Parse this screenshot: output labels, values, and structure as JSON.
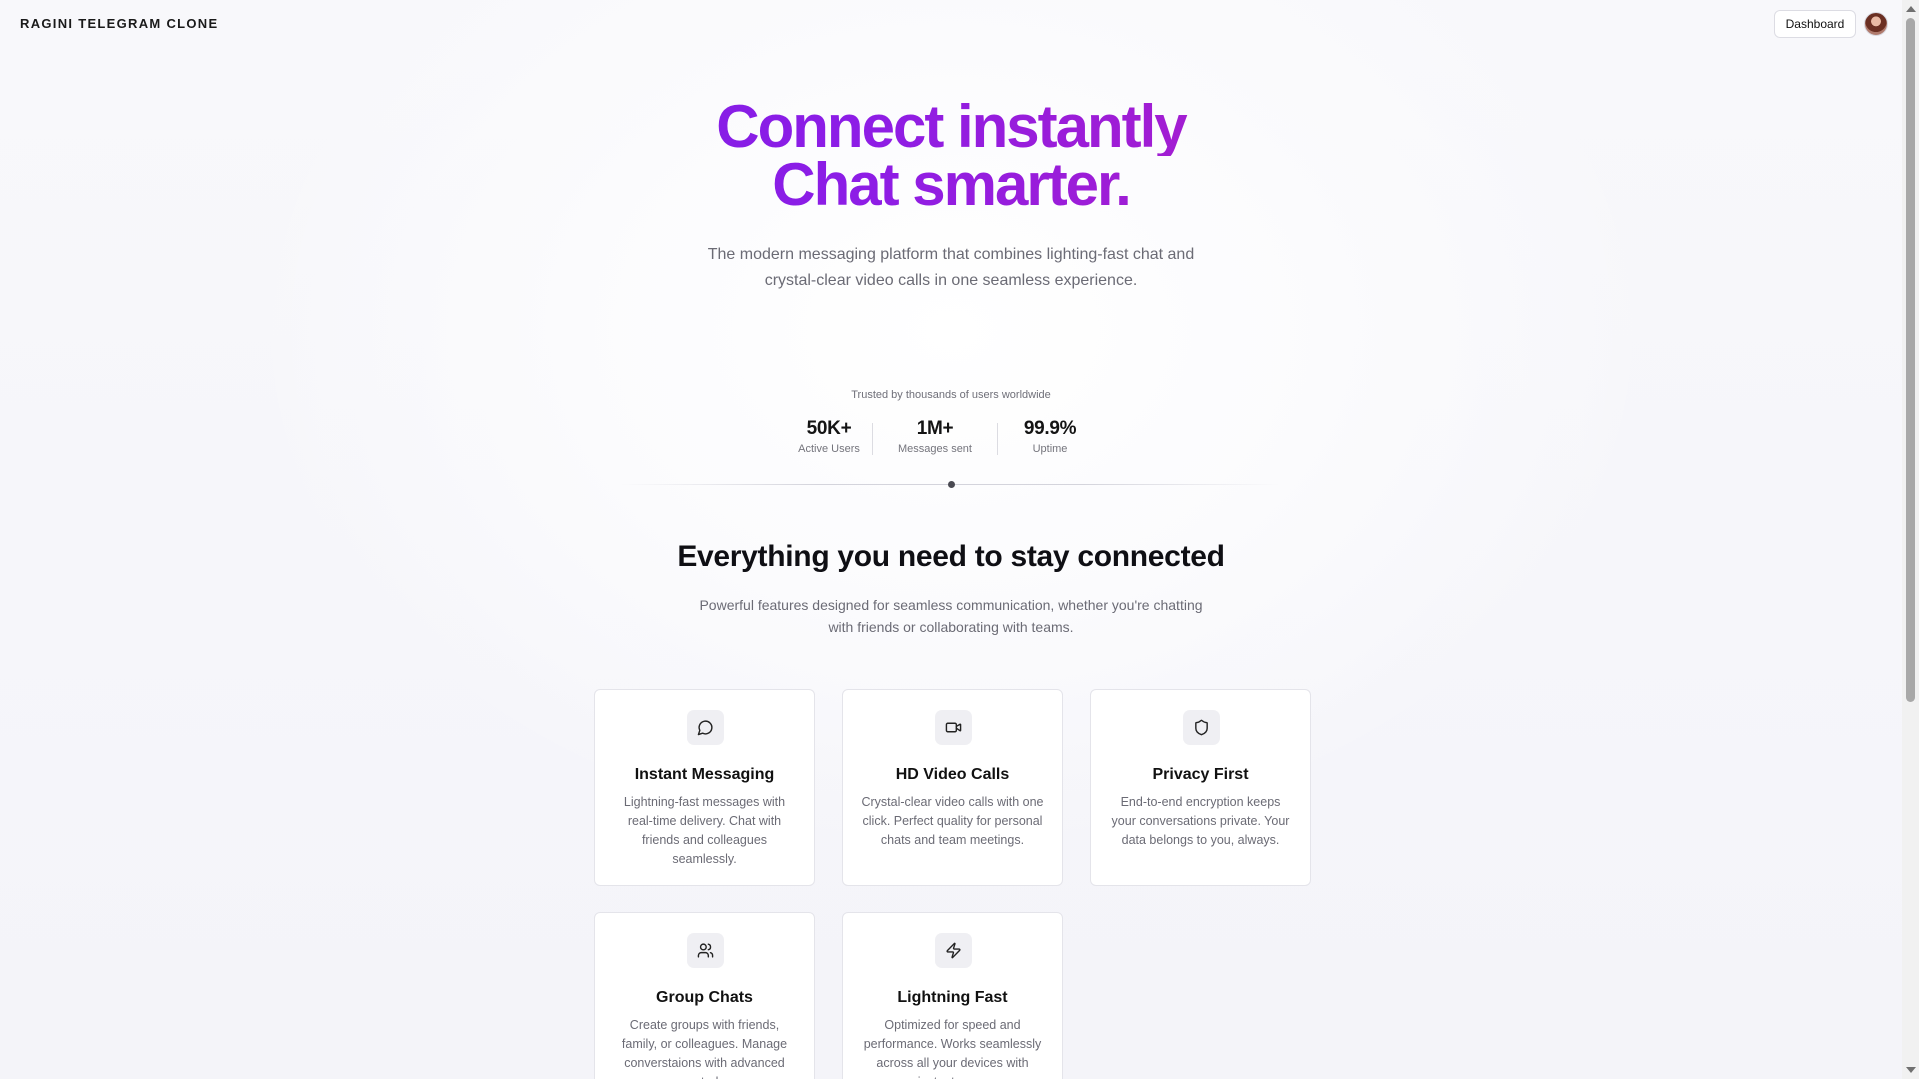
{
  "header": {
    "brand": "RAGINI TELEGRAM CLONE",
    "dashboard_label": "Dashboard"
  },
  "hero": {
    "title_line1": "Connect instantly",
    "title_line2": "Chat smarter.",
    "subtitle": "The modern messaging platform that combines lighting-fast chat and crystal-clear video calls in one seamless experience."
  },
  "stats": {
    "caption": "Trusted by thousands of users worldwide",
    "items": [
      {
        "value": "50K+",
        "label": "Active Users"
      },
      {
        "value": "1M+",
        "label": "Messages sent"
      },
      {
        "value": "99.9%",
        "label": "Uptime"
      }
    ]
  },
  "features": {
    "title": "Everything you need to stay connected",
    "subtitle": "Powerful features designed for seamless communication, whether you're chatting with friends or collaborating with teams.",
    "cards": [
      {
        "icon": "message-circle-icon",
        "title": "Instant Messaging",
        "desc": "Lightning-fast messages with real-time delivery. Chat with friends and colleagues seamlessly."
      },
      {
        "icon": "video-icon",
        "title": "HD Video Calls",
        "desc": "Crystal-clear video calls with one click. Perfect quality for personal chats and team meetings."
      },
      {
        "icon": "shield-icon",
        "title": "Privacy First",
        "desc": "End-to-end encryption keeps your conversations private. Your data belongs to you, always."
      },
      {
        "icon": "users-icon",
        "title": "Group Chats",
        "desc": "Create groups with friends, family, or colleagues. Manage converstaions with advanced controls."
      },
      {
        "icon": "zap-icon",
        "title": "Lightning Fast",
        "desc": "Optimized for speed and performance. Works seamlessly across all your devices with instant sync."
      }
    ]
  },
  "colors": {
    "gradient_start": "#6a1fe9",
    "gradient_end": "#d21b8c"
  }
}
